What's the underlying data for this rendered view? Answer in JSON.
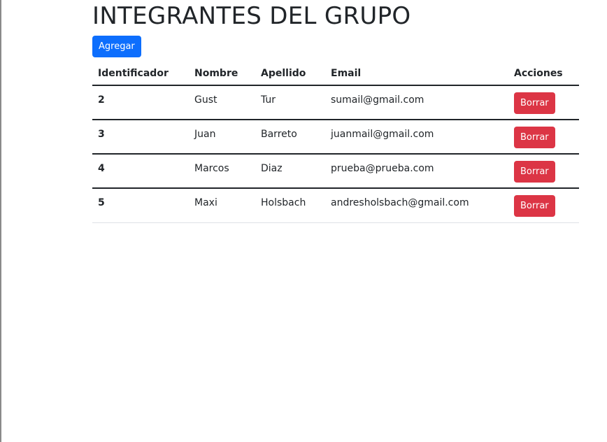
{
  "page": {
    "title": "INTEGRANTES DEL GRUPO",
    "add_button_label": "Agregar"
  },
  "table": {
    "headers": {
      "id": "Identificador",
      "nombre": "Nombre",
      "apellido": "Apellido",
      "email": "Email",
      "acciones": "Acciones"
    },
    "rows": [
      {
        "id": "2",
        "nombre": "Gust",
        "apellido": "Tur",
        "email": "sumail@gmail.com",
        "action_label": "Borrar"
      },
      {
        "id": "3",
        "nombre": "Juan",
        "apellido": "Barreto",
        "email": "juanmail@gmail.com",
        "action_label": "Borrar"
      },
      {
        "id": "4",
        "nombre": "Marcos",
        "apellido": "Diaz",
        "email": "prueba@prueba.com",
        "action_label": "Borrar"
      },
      {
        "id": "5",
        "nombre": "Maxi",
        "apellido": "Holsbach",
        "email": "andresholsbach@gmail.com",
        "action_label": "Borrar"
      }
    ]
  },
  "colors": {
    "primary": "#0d6efd",
    "danger": "#dc3545",
    "text": "#212529"
  }
}
